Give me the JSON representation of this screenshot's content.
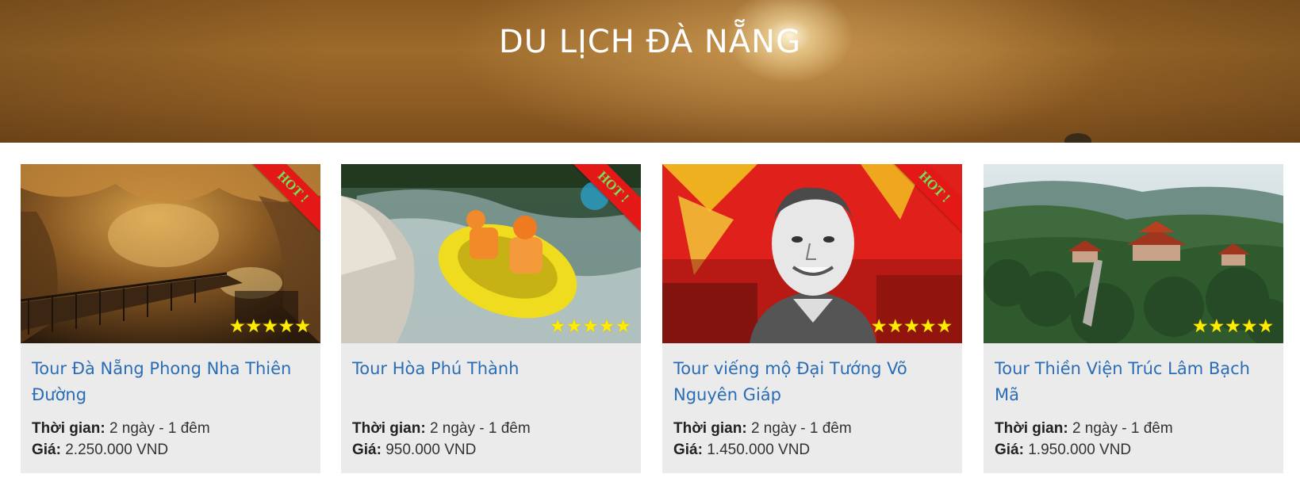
{
  "hero": {
    "title": "DU LỊCH ĐÀ NẴNG"
  },
  "cards": [
    {
      "title": "Tour Đà Nẵng Phong Nha Thiên Đường",
      "hot_label": "HOT !",
      "stars": "★★★★★",
      "time_label": "Thời gian:",
      "time_value": "2 ngày - 1 đêm",
      "price_label": "Giá:",
      "price_value": "2.250.000 VND",
      "image": "cave-photo"
    },
    {
      "title": "Tour Hòa Phú Thành",
      "hot_label": "HOT !",
      "stars": "★★★★★",
      "time_label": "Thời gian:",
      "time_value": "2 ngày - 1 đêm",
      "price_label": "Giá:",
      "price_value": "950.000 VND",
      "image": "rafting-photo"
    },
    {
      "title": "Tour viếng mộ Đại Tướng Võ Nguyên Giáp",
      "hot_label": "HOT !",
      "stars": "★★★★★",
      "time_label": "Thời gian:",
      "time_value": "2 ngày - 1 đêm",
      "price_label": "Giá:",
      "price_value": "1.450.000 VND",
      "image": "general-portrait-photo"
    },
    {
      "title": "Tour Thiền Viện Trúc Lâm Bạch Mã",
      "stars": "★★★★★",
      "time_label": "Thời gian:",
      "time_value": "2 ngày - 1 đêm",
      "price_label": "Giá:",
      "price_value": "1.950.000 VND",
      "image": "temple-forest-photo"
    }
  ],
  "colors": {
    "link": "#2a6db6",
    "card_bg": "#ebebeb",
    "ribbon": "#e51818",
    "ribbon_text": "#6fe35a",
    "stars": "#ffec00"
  }
}
